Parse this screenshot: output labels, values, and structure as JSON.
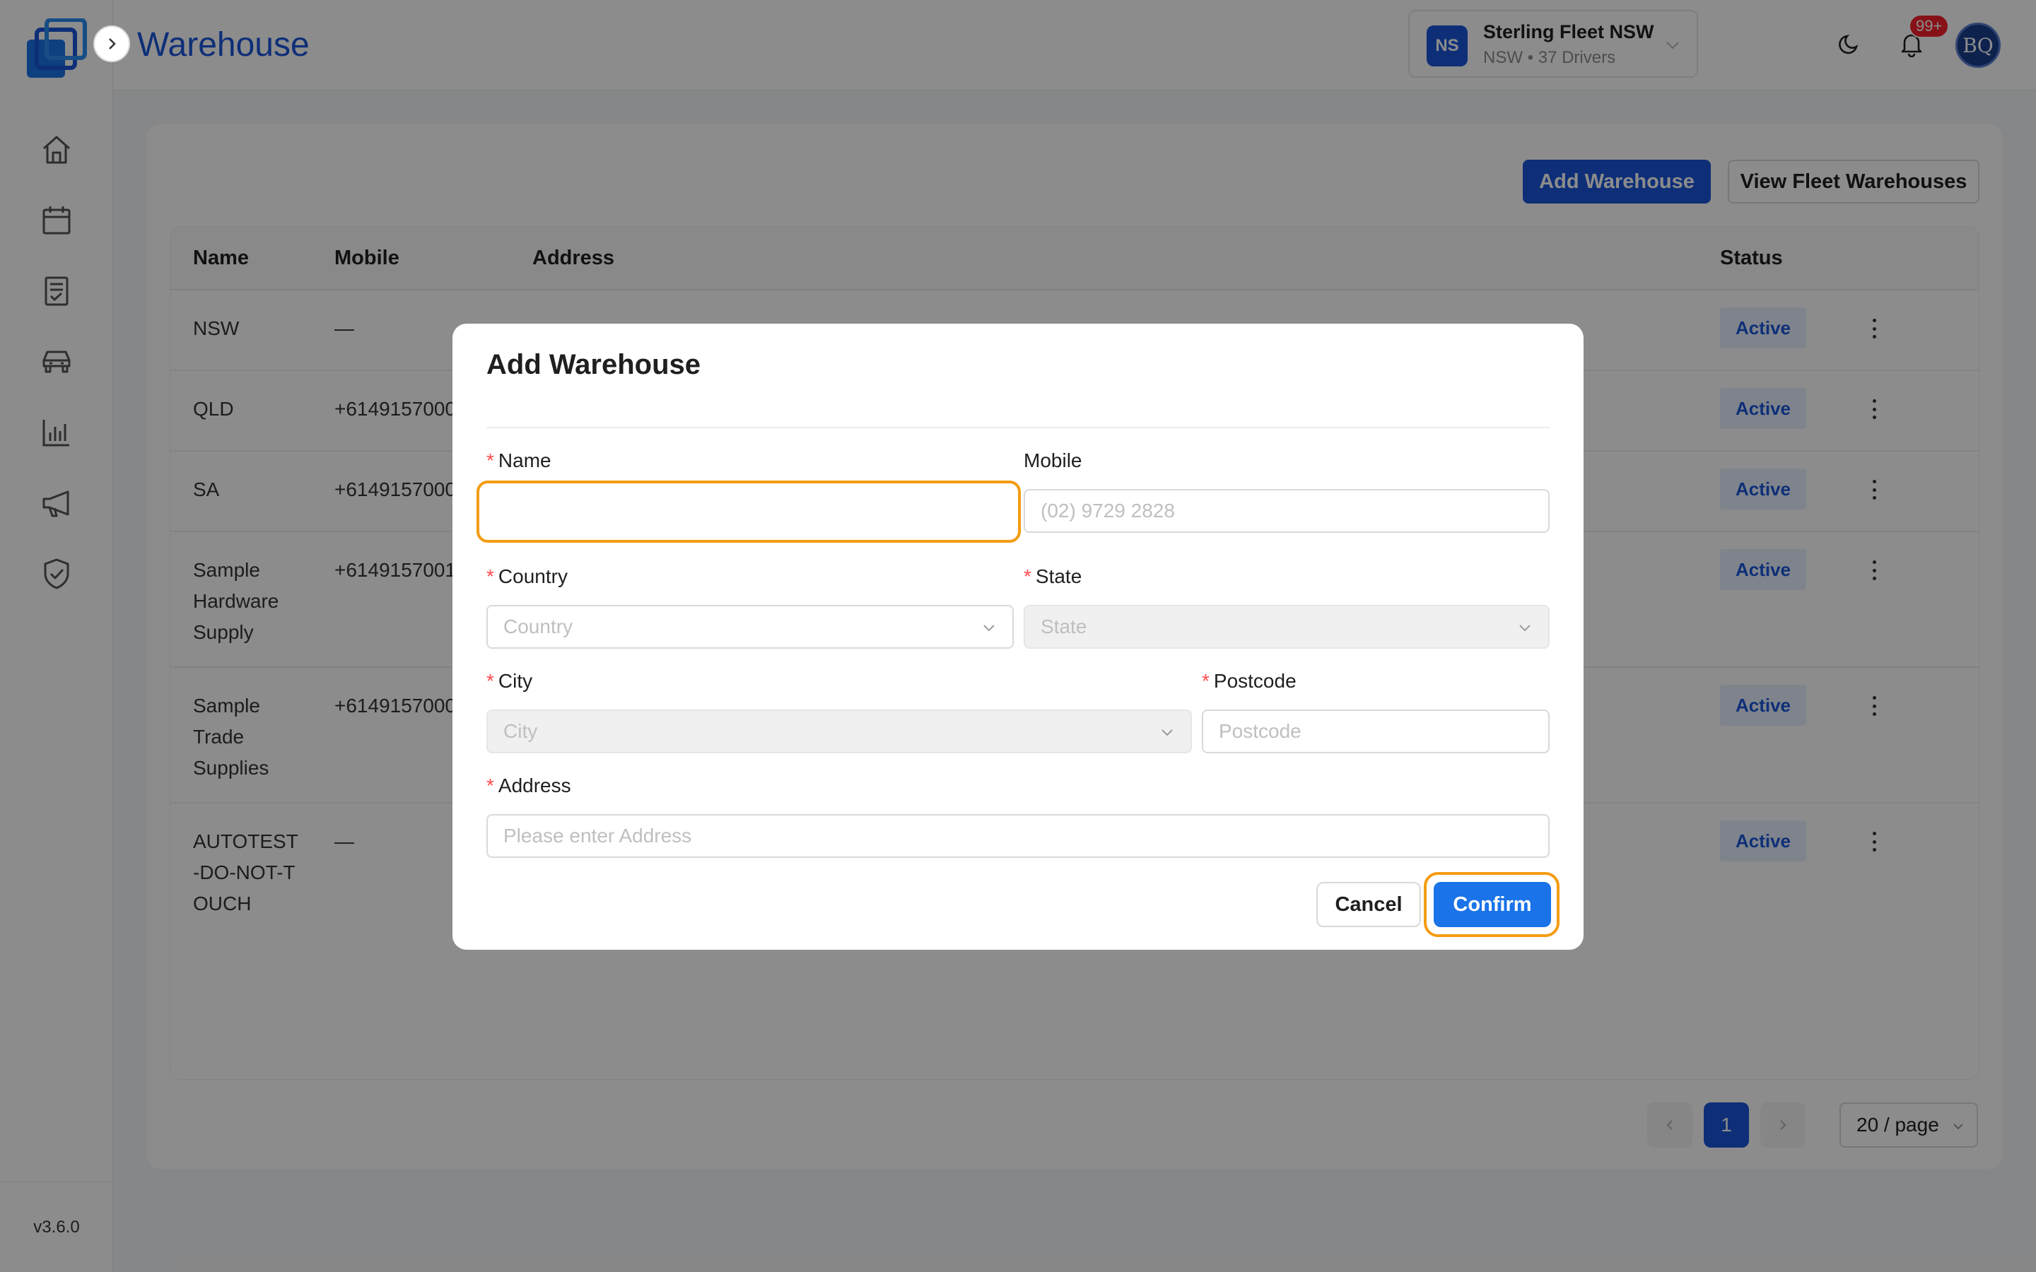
{
  "app": {
    "version": "v3.6.0"
  },
  "header": {
    "title": "Warehouse",
    "fleet": {
      "initials": "NS",
      "name": "Sterling Fleet NSW",
      "subtitle": "NSW • 37 Drivers"
    },
    "notifications_badge": "99+",
    "user_initials": "BQ"
  },
  "sidebar": {
    "items": [
      {
        "icon": "home-icon"
      },
      {
        "icon": "calendar-icon"
      },
      {
        "icon": "document-icon"
      },
      {
        "icon": "car-icon"
      },
      {
        "icon": "chart-icon"
      },
      {
        "icon": "megaphone-icon"
      },
      {
        "icon": "shield-check-icon"
      }
    ]
  },
  "toolbar": {
    "add_label": "Add Warehouse",
    "view_label": "View Fleet Warehouses"
  },
  "table": {
    "headers": {
      "name": "Name",
      "mobile": "Mobile",
      "address": "Address",
      "status": "Status"
    },
    "rows": [
      {
        "name": "NSW",
        "mobile": "—",
        "status": "Active"
      },
      {
        "name": "QLD",
        "mobile": "+6149157000",
        "status": "Active"
      },
      {
        "name": "SA",
        "mobile": "+6149157000",
        "status": "Active"
      },
      {
        "name": "Sample Hardware Supply",
        "mobile": "+6149157001",
        "status": "Active"
      },
      {
        "name": "Sample Trade Supplies",
        "mobile": "+6149157000",
        "status": "Active"
      },
      {
        "name": "AUTOTEST-DO-NOT-TOUCH",
        "mobile": "—",
        "status": "Active"
      }
    ]
  },
  "pagination": {
    "current_page": "1",
    "page_size": "20 / page"
  },
  "modal": {
    "title": "Add Warehouse",
    "name_label": "Name",
    "name_value": "",
    "mobile_label": "Mobile",
    "mobile_placeholder": "(02) 9729 2828",
    "country_label": "Country",
    "country_placeholder": "Country",
    "state_label": "State",
    "state_placeholder": "State",
    "city_label": "City",
    "city_placeholder": "City",
    "postcode_label": "Postcode",
    "postcode_placeholder": "Postcode",
    "address_label": "Address",
    "address_placeholder": "Please enter Address",
    "cancel_label": "Cancel",
    "confirm_label": "Confirm"
  },
  "colors": {
    "primary": "#1a56db",
    "focus_ring": "#f39c12",
    "required": "#ff4d4f"
  }
}
